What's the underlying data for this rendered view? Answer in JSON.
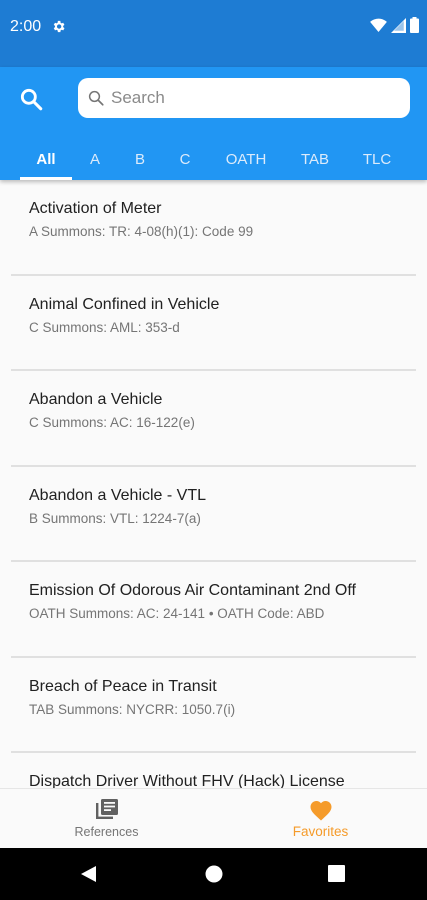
{
  "status": {
    "time": "2:00",
    "icons": [
      "gear-icon",
      "wifi-icon",
      "signal-icon",
      "battery-icon"
    ]
  },
  "search": {
    "placeholder": "Search"
  },
  "tabs": [
    {
      "label": "All",
      "active": true
    },
    {
      "label": "A"
    },
    {
      "label": "B"
    },
    {
      "label": "C"
    },
    {
      "label": "OATH"
    },
    {
      "label": "TAB"
    },
    {
      "label": "TLC"
    }
  ],
  "items": [
    {
      "title": "Activation of Meter",
      "sub": "A Summons: TR: 4-08(h)(1): Code 99"
    },
    {
      "title": "Animal Confined in Vehicle",
      "sub": "C Summons: AML: 353-d"
    },
    {
      "title": "Abandon a Vehicle",
      "sub": "C Summons: AC: 16-122(e)"
    },
    {
      "title": "Abandon a Vehicle - VTL",
      "sub": "B Summons: VTL: 1224-7(a)"
    },
    {
      "title": "Emission Of Odorous Air Contaminant 2nd Off",
      "sub": "OATH Summons: AC: 24-141 • OATH Code: ABD"
    },
    {
      "title": "Breach of Peace in Transit",
      "sub": "TAB Summons: NYCRR: 1050.7(i)"
    },
    {
      "title": "Dispatch Driver Without FHV (Hack) License",
      "sub": ""
    }
  ],
  "bottom_nav": {
    "references": {
      "label": "References",
      "icon": "book-icon"
    },
    "favorites": {
      "label": "Favorites",
      "icon": "heart-icon"
    }
  },
  "colors": {
    "primary": "#2196f3",
    "status_bar": "#1e7cd3",
    "accent": "#f59b2a"
  }
}
